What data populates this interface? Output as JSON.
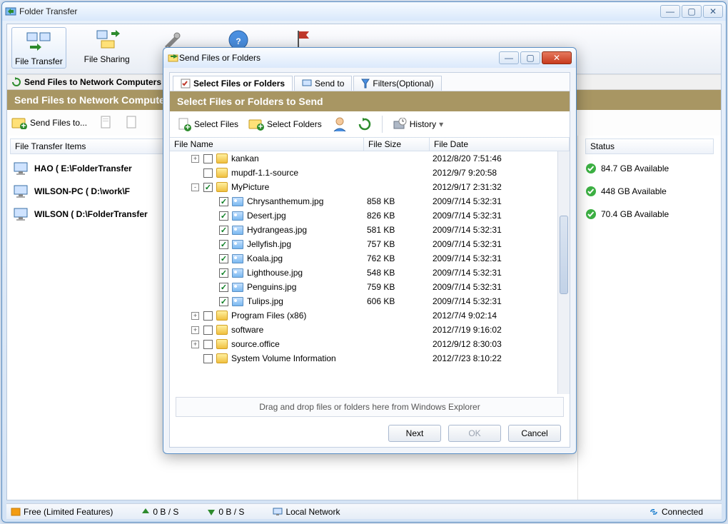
{
  "main": {
    "title": "Folder Transfer",
    "toolbar": [
      {
        "label": "File Transfer",
        "selected": true
      },
      {
        "label": "File Sharing",
        "selected": false
      }
    ],
    "section_bar": "Send Files to Network Computers",
    "section_header": "Send Files to Network Computers",
    "action_send": "Send Files to...",
    "left_header": "File Transfer Items",
    "right_header": "Status",
    "transfer_items": [
      "HAO ( E:\\FolderTransfer",
      "WILSON-PC ( D:\\work\\F",
      "WILSON ( D:\\FolderTransfer"
    ],
    "status_items": [
      "84.7 GB Available",
      "448 GB Available",
      "70.4 GB Available"
    ],
    "statusbar": {
      "free": "Free (Limited Features)",
      "up": "0 B / S",
      "down": "0 B / S",
      "net": "Local Network",
      "conn": "Connected"
    }
  },
  "dialog": {
    "title": "Send Files or Folders",
    "tabs": [
      {
        "label": "Select Files or Folders",
        "active": true
      },
      {
        "label": "Send to",
        "active": false
      },
      {
        "label": "Filters(Optional)",
        "active": false
      }
    ],
    "header": "Select Files or Folders to Send",
    "toolbar": {
      "select_files": "Select Files",
      "select_folders": "Select Folders",
      "history": "History"
    },
    "columns": {
      "name": "File Name",
      "size": "File Size",
      "date": "File Date"
    },
    "rows": [
      {
        "indent": 1,
        "exp": "+",
        "chk": false,
        "type": "folder",
        "name": "kankan",
        "size": "",
        "date": "2012/8/20 7:51:46"
      },
      {
        "indent": 1,
        "exp": "",
        "chk": false,
        "type": "folder",
        "name": "mupdf-1.1-source",
        "size": "",
        "date": "2012/9/7 9:20:58"
      },
      {
        "indent": 1,
        "exp": "-",
        "chk": true,
        "type": "folder",
        "name": "MyPicture",
        "size": "",
        "date": "2012/9/17 2:31:32"
      },
      {
        "indent": 2,
        "exp": "",
        "chk": true,
        "type": "img",
        "name": "Chrysanthemum.jpg",
        "size": "858 KB",
        "date": "2009/7/14 5:32:31"
      },
      {
        "indent": 2,
        "exp": "",
        "chk": true,
        "type": "img",
        "name": "Desert.jpg",
        "size": "826 KB",
        "date": "2009/7/14 5:32:31"
      },
      {
        "indent": 2,
        "exp": "",
        "chk": true,
        "type": "img",
        "name": "Hydrangeas.jpg",
        "size": "581 KB",
        "date": "2009/7/14 5:32:31"
      },
      {
        "indent": 2,
        "exp": "",
        "chk": true,
        "type": "img",
        "name": "Jellyfish.jpg",
        "size": "757 KB",
        "date": "2009/7/14 5:32:31"
      },
      {
        "indent": 2,
        "exp": "",
        "chk": true,
        "type": "img",
        "name": "Koala.jpg",
        "size": "762 KB",
        "date": "2009/7/14 5:32:31"
      },
      {
        "indent": 2,
        "exp": "",
        "chk": true,
        "type": "img",
        "name": "Lighthouse.jpg",
        "size": "548 KB",
        "date": "2009/7/14 5:32:31"
      },
      {
        "indent": 2,
        "exp": "",
        "chk": true,
        "type": "img",
        "name": "Penguins.jpg",
        "size": "759 KB",
        "date": "2009/7/14 5:32:31"
      },
      {
        "indent": 2,
        "exp": "",
        "chk": true,
        "type": "img",
        "name": "Tulips.jpg",
        "size": "606 KB",
        "date": "2009/7/14 5:32:31"
      },
      {
        "indent": 1,
        "exp": "+",
        "chk": false,
        "type": "folder",
        "name": "Program Files (x86)",
        "size": "",
        "date": "2012/7/4 9:02:14"
      },
      {
        "indent": 1,
        "exp": "+",
        "chk": false,
        "type": "folder",
        "name": "software",
        "size": "",
        "date": "2012/7/19 9:16:02"
      },
      {
        "indent": 1,
        "exp": "+",
        "chk": false,
        "type": "folder",
        "name": "source.office",
        "size": "",
        "date": "2012/9/12 8:30:03"
      },
      {
        "indent": 1,
        "exp": "",
        "chk": false,
        "type": "folder",
        "name": "System Volume Information",
        "size": "",
        "date": "2012/7/23 8:10:22"
      }
    ],
    "dropzone": "Drag and drop files or folders here from Windows Explorer",
    "buttons": {
      "next": "Next",
      "ok": "OK",
      "cancel": "Cancel"
    }
  }
}
